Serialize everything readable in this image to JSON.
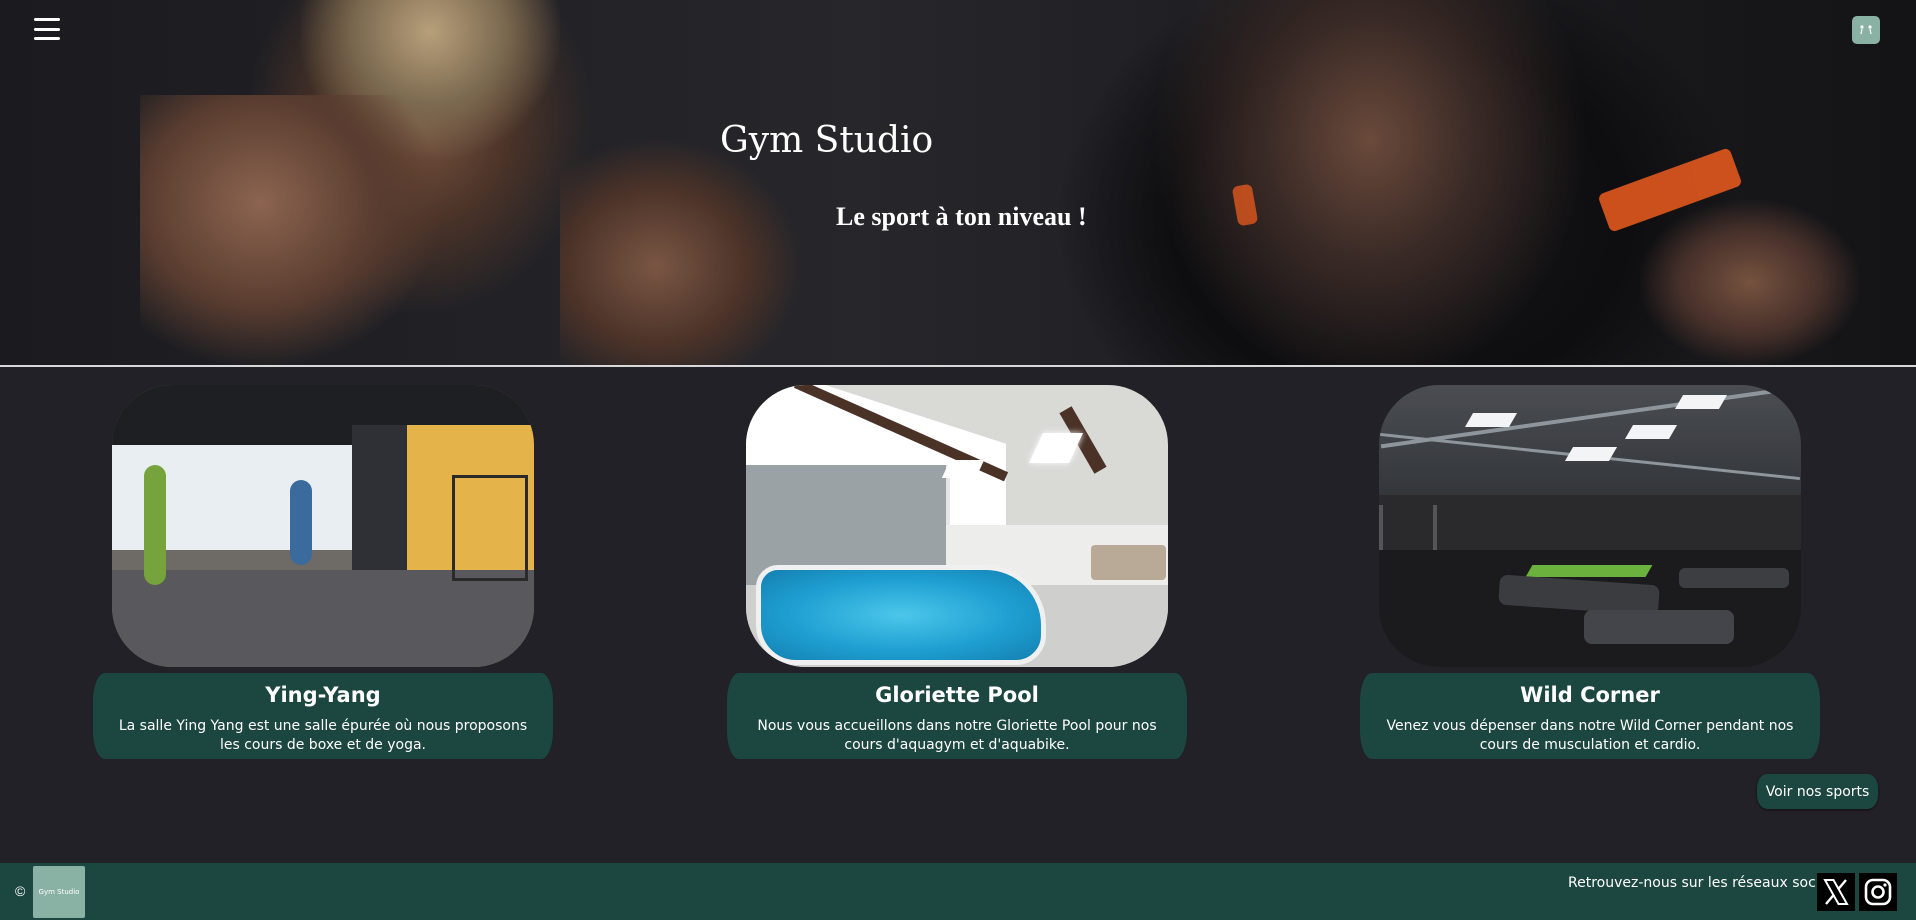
{
  "header": {
    "title": "Gym Studio",
    "tagline": "Le sport à ton niveau !",
    "menu_icon": "hamburger-menu-icon",
    "logo_icon": "gym-studio-logo"
  },
  "cards": [
    {
      "title": "Ying-Yang",
      "description": "La salle Ying Yang est une salle épurée où nous proposons les cours de boxe et de yoga."
    },
    {
      "title": "Gloriette Pool",
      "description": "Nous vous accueillons dans notre Gloriette Pool pour nos cours d'aquagym et d'aquabike."
    },
    {
      "title": "Wild Corner",
      "description": "Venez vous dépenser dans notre Wild Corner pendant nos cours de musculation et cardio."
    }
  ],
  "cta": {
    "label": "Voir nos sports"
  },
  "footer": {
    "copyright": "©",
    "logo_text": "Gym Studio",
    "social_text": "Retrouvez-nous sur les réseaux sociaux :",
    "social_icons": [
      "x-icon",
      "instagram-icon"
    ]
  },
  "colors": {
    "background": "#222127",
    "accent": "#1c4640",
    "logo_bg": "#8ab2a4"
  }
}
